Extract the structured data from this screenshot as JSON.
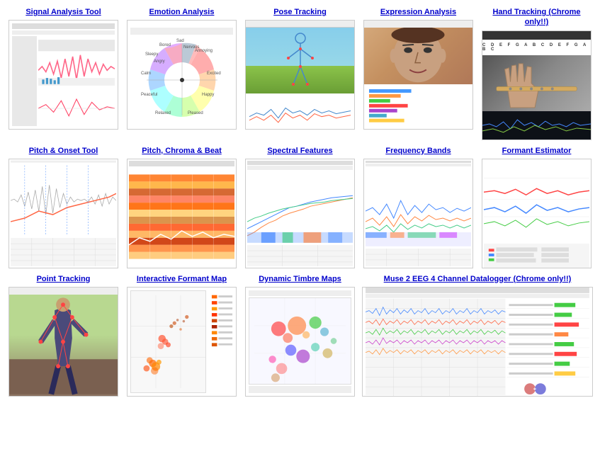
{
  "rows": [
    {
      "id": "row1",
      "items": [
        {
          "id": "signal-analysis",
          "title": "Signal Analysis Tool",
          "link": true,
          "subtitle": null
        },
        {
          "id": "emotion-analysis",
          "title": "Emotion Analysis",
          "link": true,
          "subtitle": null
        },
        {
          "id": "pose-tracking",
          "title": "Pose Tracking",
          "link": true,
          "subtitle": null
        },
        {
          "id": "expression-analysis",
          "title": "Expression Analysis",
          "link": true,
          "subtitle": null
        },
        {
          "id": "hand-tracking",
          "title": "Hand Tracking (Chrome only!!)",
          "link": true,
          "subtitle": null
        }
      ]
    },
    {
      "id": "row2",
      "items": [
        {
          "id": "pitch-onset",
          "title": "Pitch & Onset Tool",
          "link": true,
          "subtitle": null
        },
        {
          "id": "pitch-chroma-beat",
          "title": "Pitch, Chroma & Beat",
          "link": true,
          "subtitle": null
        },
        {
          "id": "spectral-features",
          "title": "Spectral Features",
          "link": true,
          "subtitle": null
        },
        {
          "id": "frequency-bands",
          "title": "Frequency Bands",
          "link": true,
          "subtitle": null
        },
        {
          "id": "formant-estimator",
          "title": "Formant Estimator",
          "link": true,
          "subtitle": null
        }
      ]
    },
    {
      "id": "row3",
      "items": [
        {
          "id": "point-tracking",
          "title": "Point Tracking",
          "link": true,
          "subtitle": null
        },
        {
          "id": "interactive-formant-map",
          "title": "Interactive Formant Map",
          "link": true,
          "subtitle": null
        },
        {
          "id": "dynamic-timbre-maps",
          "title": "Dynamic Timbre Maps",
          "link": true,
          "subtitle": null
        },
        {
          "id": "muse-eeg",
          "title": "Muse 2 EEG 4 Channel Datalogger (Chrome only!!)",
          "link": true,
          "subtitle": null,
          "wide": true
        }
      ]
    }
  ],
  "emotions": [
    "Annoying",
    "Excited",
    "Happy",
    "Pleased",
    "Relaxed",
    "Peaceful",
    "Calm",
    "Sleepy",
    "Bored",
    "Sad",
    "Nervous",
    "Angry"
  ],
  "piano_keys": "C D E F G A B C D E F G A B C"
}
